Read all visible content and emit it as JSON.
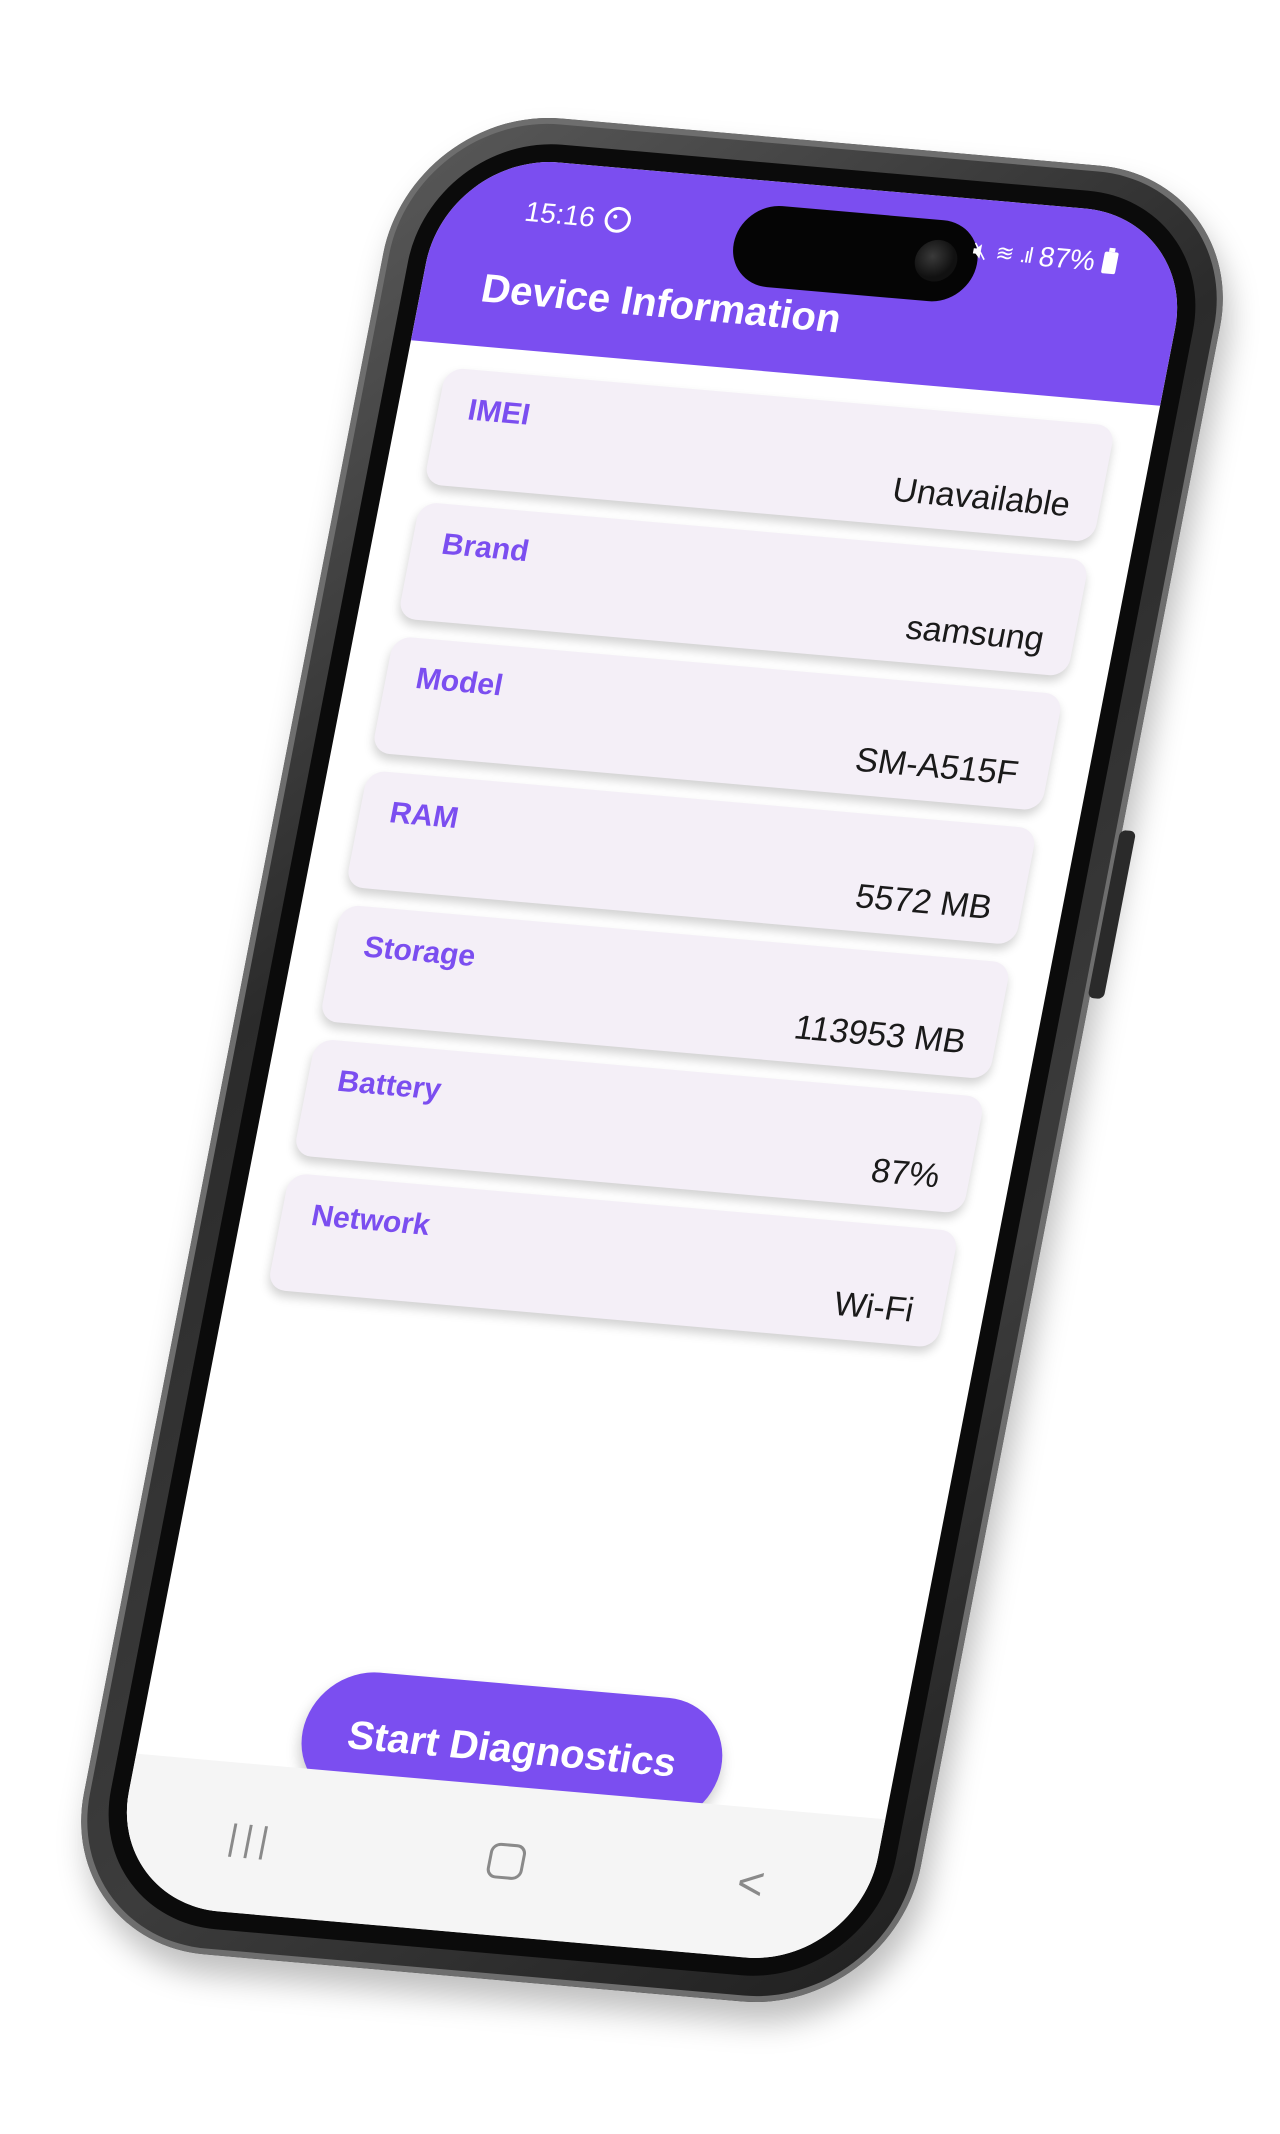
{
  "status_bar": {
    "time": "15:16",
    "settings_icon": "gear-icon",
    "mute_icon": "mute-icon",
    "wifi_icon": "wifi-icon",
    "signal_icon": "signal-icon",
    "battery_text": "87%",
    "battery_icon": "battery-icon"
  },
  "app": {
    "title": "Device Information",
    "accent_color": "#7b4ef0",
    "card_background": "#f4eff7"
  },
  "info_items": [
    {
      "label": "IMEI",
      "value": "Unavailable"
    },
    {
      "label": "Brand",
      "value": "samsung"
    },
    {
      "label": "Model",
      "value": "SM-A515F"
    },
    {
      "label": "RAM",
      "value": "5572 MB"
    },
    {
      "label": "Storage",
      "value": "113953 MB"
    },
    {
      "label": "Battery",
      "value": "87%"
    },
    {
      "label": "Network",
      "value": "Wi-Fi"
    }
  ],
  "actions": {
    "start_label": "Start Diagnostics"
  },
  "nav_bar": {
    "recents": "|||",
    "home_icon": "home-icon",
    "back": "<"
  }
}
